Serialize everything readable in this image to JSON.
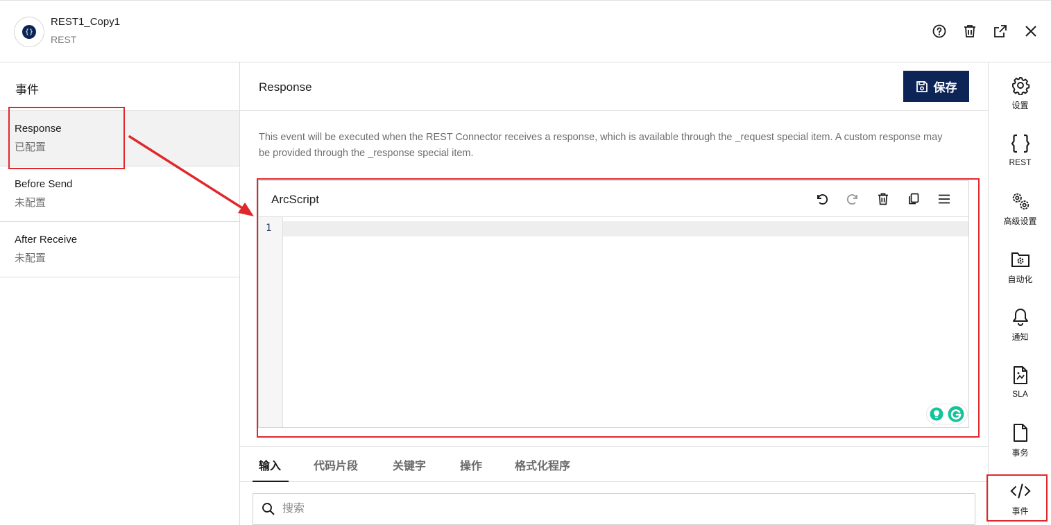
{
  "header": {
    "title": "REST1_Copy1",
    "subtitle": "REST",
    "logo_glyph": "{}",
    "icons": [
      "help-icon",
      "trash-icon",
      "external-link-icon",
      "close-icon"
    ]
  },
  "left": {
    "title": "事件",
    "events": [
      {
        "name": "Response",
        "status": "已配置",
        "selected": true
      },
      {
        "name": "Before Send",
        "status": "未配置",
        "selected": false
      },
      {
        "name": "After Receive",
        "status": "未配置",
        "selected": false
      }
    ]
  },
  "main": {
    "title": "Response",
    "save_label": "保存",
    "description": "This event will be executed when the REST Connector receives a response, which is available through the _request special item. A custom response may be provided through the _response special item.",
    "editor": {
      "title": "ArcScript",
      "line_number": "1",
      "tools": [
        "undo-icon",
        "redo-icon",
        "trash-icon",
        "copy-icon",
        "menu-icon"
      ]
    },
    "tabs": [
      "输入",
      "代码片段",
      "关键字",
      "操作",
      "格式化程序"
    ],
    "active_tab": "输入",
    "search": {
      "placeholder": "搜索",
      "value": ""
    }
  },
  "rail": {
    "items": [
      {
        "label": "设置",
        "icon": "gear-icon"
      },
      {
        "label": "REST",
        "icon": "braces-icon"
      },
      {
        "label": "高级设置",
        "icon": "gears-icon"
      },
      {
        "label": "自动化",
        "icon": "folder-gear-icon"
      },
      {
        "label": "通知",
        "icon": "bell-icon"
      },
      {
        "label": "SLA",
        "icon": "chart-file-icon"
      },
      {
        "label": "事务",
        "icon": "file-icon"
      },
      {
        "label": "事件",
        "icon": "code-icon"
      }
    ]
  },
  "colors": {
    "brand": "#0d2556",
    "highlight": "#e0282c"
  }
}
